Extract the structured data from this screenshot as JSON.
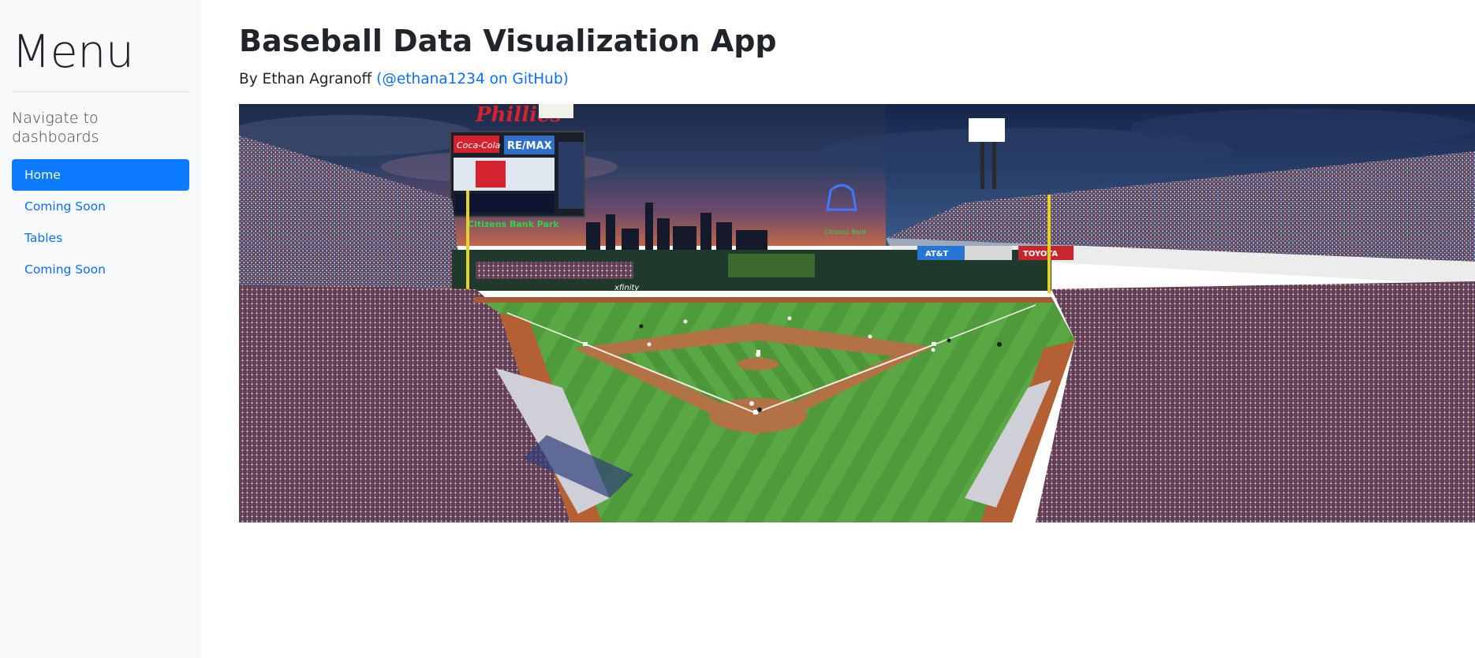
{
  "sidebar": {
    "title": "Menu",
    "subtitle": "Navigate to dashboards",
    "items": [
      {
        "label": "Home",
        "active": true
      },
      {
        "label": "Coming Soon",
        "active": false
      },
      {
        "label": "Tables",
        "active": false
      },
      {
        "label": "Coming Soon",
        "active": false
      }
    ]
  },
  "main": {
    "title": "Baseball Data Visualization App",
    "byline_prefix": "By Ethan Agranoff ",
    "byline_link": "(@ethana1234 on GitHub)"
  },
  "hero_image": {
    "subject": "baseball-stadium-photo",
    "signage_lettering": [
      "Phillies",
      "Coca-Cola",
      "RE/MAX",
      "Citizens Bank Park",
      "AT&T",
      "TOYOTA",
      "xfinity"
    ]
  },
  "colors": {
    "accent": "#0d7bfd",
    "link": "#0d6efd",
    "sidebar_bg": "#f8f9fa",
    "text": "#212529"
  }
}
